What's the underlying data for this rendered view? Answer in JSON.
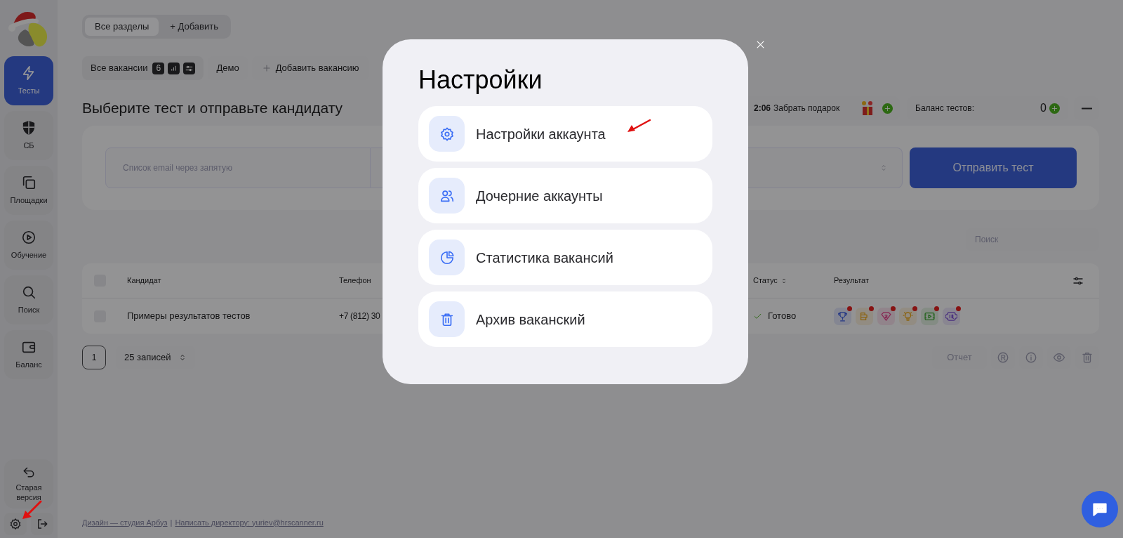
{
  "sections_bar": {
    "tabs": [
      {
        "label": "Все разделы",
        "selected": true
      },
      {
        "label": "+ Добавить",
        "selected": false
      }
    ]
  },
  "vacancies_bar": {
    "all": {
      "label": "Все вакансии",
      "count": "6"
    },
    "items": [
      {
        "kind": "plain",
        "label": "Демо"
      },
      {
        "kind": "add",
        "label": "Добавить вакансию"
      }
    ]
  },
  "sidebar": {
    "items": [
      {
        "kind": "bolt",
        "label": "Тесты",
        "selected": true
      },
      {
        "kind": "shield",
        "label": "СБ",
        "selected": false
      },
      {
        "kind": "copy",
        "label": "Площадки",
        "selected": false
      },
      {
        "kind": "play",
        "label": "Обучение",
        "selected": false
      },
      {
        "kind": "search",
        "label": "Поиск",
        "selected": false
      },
      {
        "kind": "wallet",
        "label": "Баланс",
        "selected": false
      }
    ],
    "old_version": "Старая версия"
  },
  "heading": "Выберите тест и отправьте кандидату",
  "gift": {
    "timer": "2:06",
    "label": "Забрать подарок"
  },
  "balance": {
    "label": "Баланс тестов:",
    "value": "0"
  },
  "send_form": {
    "email_placeholder": "Список email через запятую",
    "button": "Отправить тест"
  },
  "search": {
    "placeholder": "Поиск"
  },
  "table": {
    "select_all_checked": false,
    "columns": [
      "Кандидат",
      "Телефон",
      "Статус",
      "Результат"
    ],
    "rows": [
      {
        "checked": false,
        "candidate": "Примеры результатов тестов",
        "phone": "+7 (812) 30",
        "status": "Готово",
        "results": [
          {
            "kind": "trophy"
          },
          {
            "kind": "bars"
          },
          {
            "kind": "gem"
          },
          {
            "kind": "bulb"
          },
          {
            "kind": "video"
          },
          {
            "kind": "iq"
          }
        ]
      }
    ]
  },
  "pagination": {
    "page": "1",
    "per_page": "25 записей"
  },
  "actions": {
    "report": "Отчет"
  },
  "footer": [
    "Дизайн — студия Арбуз",
    "|",
    "Написать директору: yuriev@hrscanner.ru"
  ],
  "modal": {
    "title": "Настройки",
    "items": [
      {
        "kind": "gear",
        "label": "Настройки аккаунта",
        "annotated": true
      },
      {
        "kind": "users",
        "label": "Дочерние аккаунты",
        "annotated": false
      },
      {
        "kind": "pie",
        "label": "Статистика вакансий",
        "annotated": false
      },
      {
        "kind": "trash",
        "label": "Архив ваканский",
        "annotated": false
      }
    ]
  }
}
